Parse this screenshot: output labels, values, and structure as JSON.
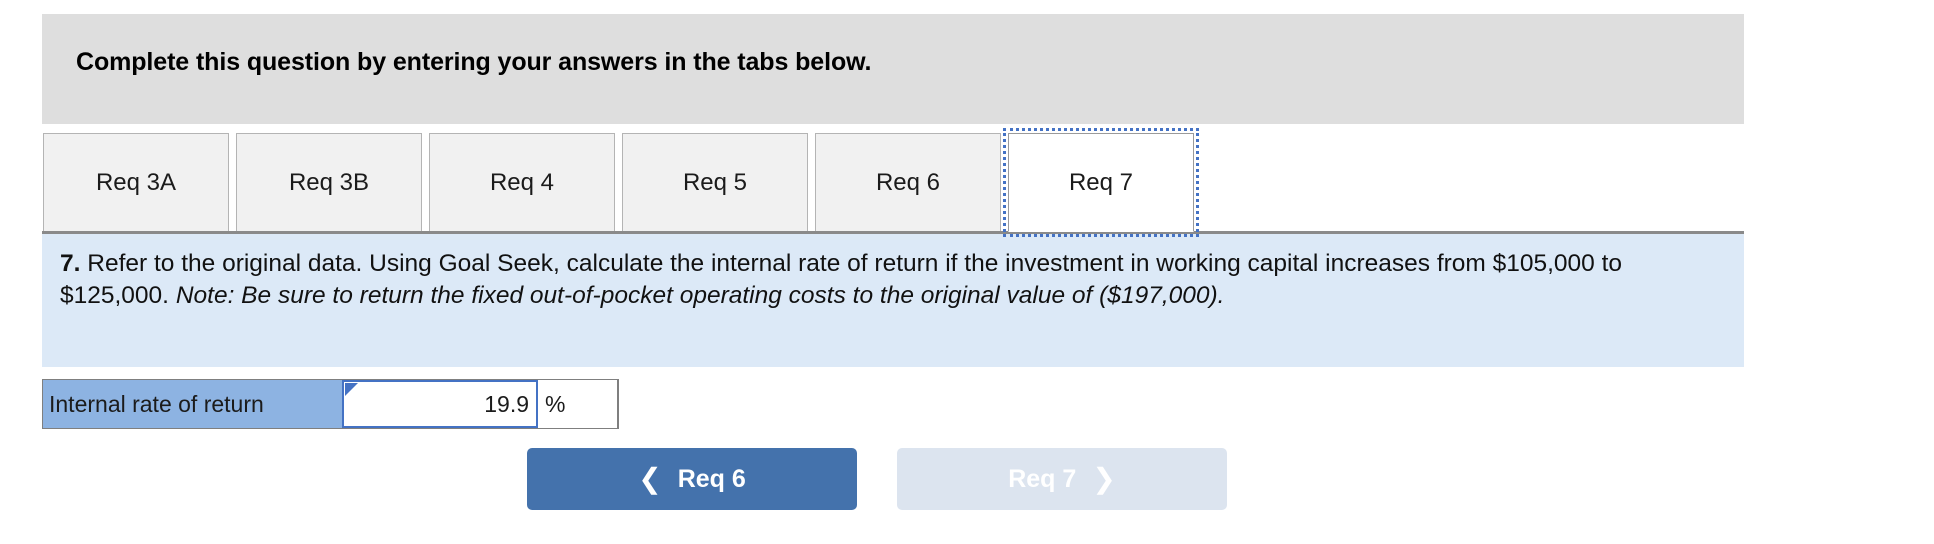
{
  "banner": {
    "instruction": "Complete this question by entering your answers in the tabs below."
  },
  "tabs": [
    {
      "label": "Req 3A",
      "active": false
    },
    {
      "label": "Req 3B",
      "active": false
    },
    {
      "label": "Req 4",
      "active": false
    },
    {
      "label": "Req 5",
      "active": false
    },
    {
      "label": "Req 6",
      "active": false
    },
    {
      "label": "Req 7",
      "active": true
    }
  ],
  "question": {
    "number": "7.",
    "body_part1": " Refer to the original data. Using Goal Seek, calculate the internal rate of return if the investment in working capital increases from $105,000 to $125,000. ",
    "note": "Note: Be sure to return the fixed out-of-pocket operating costs to the original value of ($197,000).",
    "full_text": "7. Refer to the original data. Using Goal Seek, calculate the internal rate of return if the investment in working capital increases from $105,000 to $125,000. Note: Be sure to return the fixed out-of-pocket operating costs to the original value of ($197,000)."
  },
  "answer_row": {
    "label": "Internal rate of return",
    "value": "19.9",
    "unit": "%",
    "cell_marker_icon": "cell-marker-triangle-icon"
  },
  "nav": {
    "prev_label": "Req 6",
    "prev_icon": "chevron-left-icon",
    "next_label": "Req 7",
    "next_icon": "chevron-right-icon",
    "prev_enabled": "true",
    "next_enabled": "false"
  },
  "colors": {
    "banner_bg": "#dedede",
    "panel_bg": "#dce9f7",
    "tab_bg": "#f1f1f1",
    "tab_active_bg": "#ffffff",
    "selection_outline": "#4472c4",
    "label_cell_bg": "#8db3e2",
    "prev_button_bg": "#4472ac",
    "next_button_bg": "#dce4ef"
  }
}
